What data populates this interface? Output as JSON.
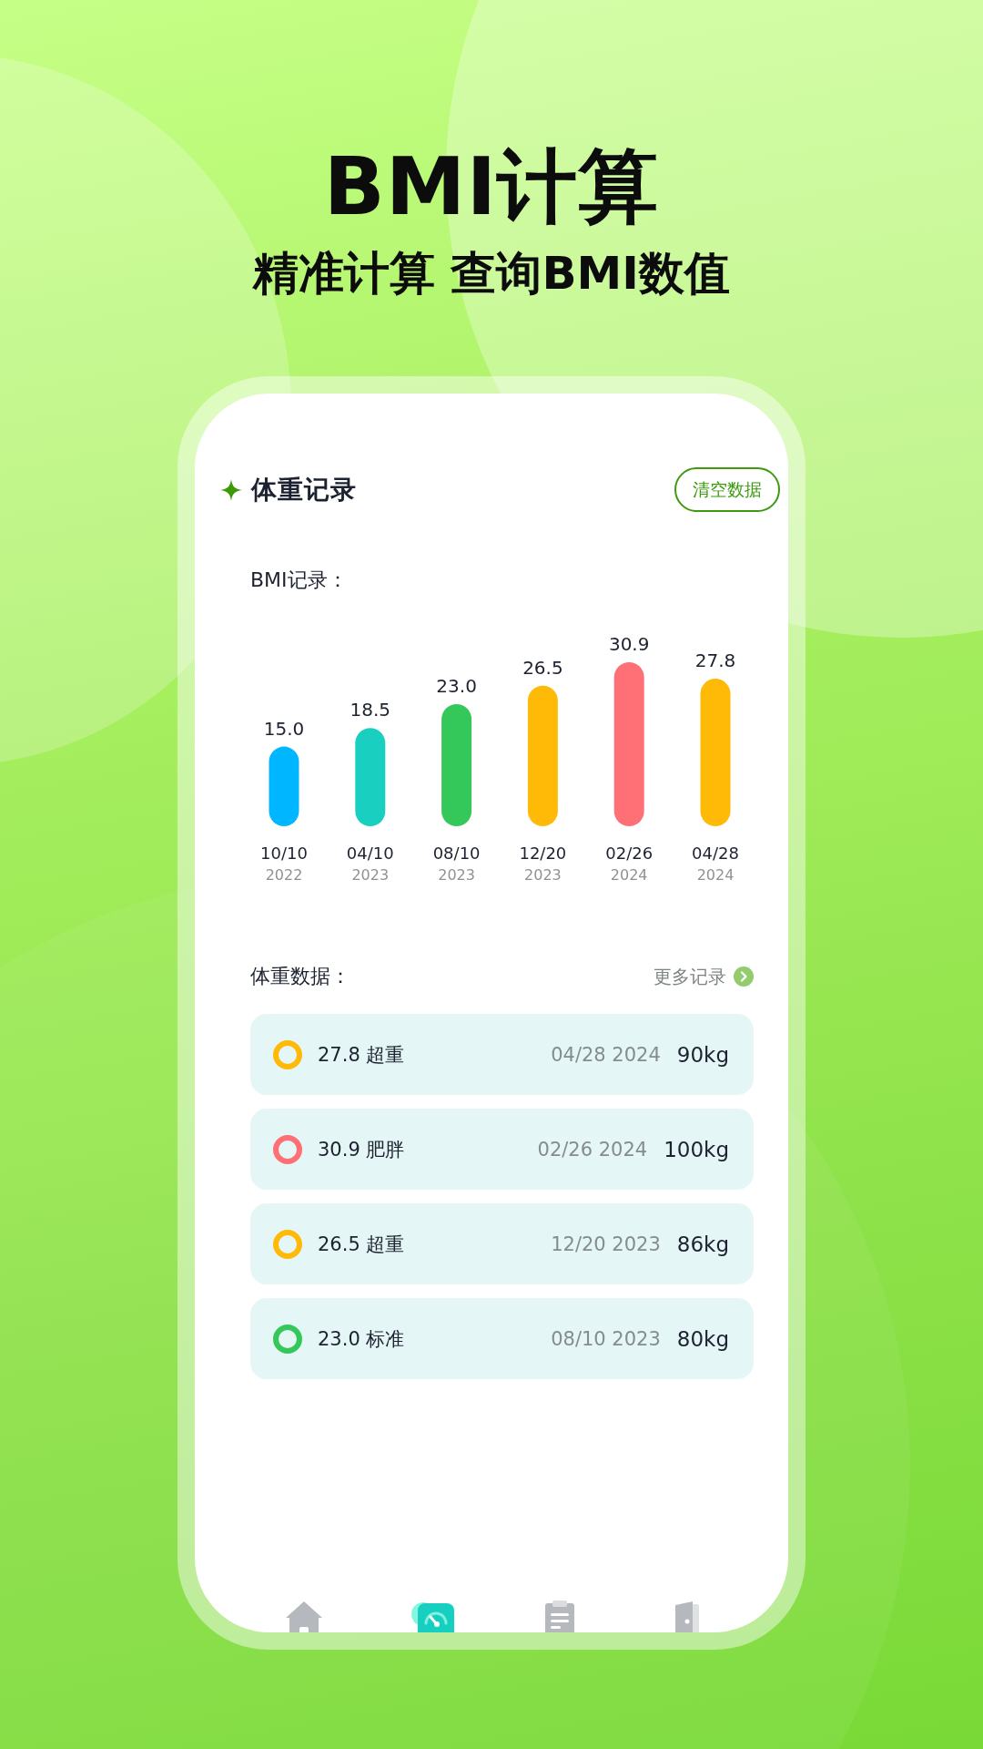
{
  "headline": {
    "title": "BMI计算",
    "subtitle": "精准计算 查询BMI数值"
  },
  "screen": {
    "header": {
      "title": "体重记录",
      "action": "清空数据"
    },
    "bmi_chart": {
      "title": "BMI记录：",
      "chart_data": {
        "type": "bar",
        "categories": [
          "10/10",
          "04/10",
          "08/10",
          "12/20",
          "02/26",
          "04/28"
        ],
        "values": [
          15.0,
          18.5,
          23.0,
          26.5,
          30.9,
          27.8
        ],
        "value_labels": [
          "15.0",
          "18.5",
          "23.0",
          "26.5",
          "30.9",
          "27.8"
        ]
      },
      "bars": [
        {
          "year": "2022",
          "color": "#00b7ff"
        },
        {
          "year": "2023",
          "color": "#18cfc0"
        },
        {
          "year": "2023",
          "color": "#34c759"
        },
        {
          "year": "2023",
          "color": "#ffba08"
        },
        {
          "year": "2024",
          "color": "#ff6f76"
        },
        {
          "year": "2024",
          "color": "#ffba08"
        }
      ]
    },
    "weight_data": {
      "title": "体重数据：",
      "more_link": "更多记录",
      "records": [
        {
          "bmi": "27.8",
          "status": "超重",
          "date": "04/28 2024",
          "weight": "90kg",
          "color": "#ffba08"
        },
        {
          "bmi": "30.9",
          "status": "肥胖",
          "date": "02/26 2024",
          "weight": "100kg",
          "color": "#ff6f76"
        },
        {
          "bmi": "26.5",
          "status": "超重",
          "date": "12/20 2023",
          "weight": "86kg",
          "color": "#ffba08"
        },
        {
          "bmi": "23.0",
          "status": "标准",
          "date": "08/10 2023",
          "weight": "80kg",
          "color": "#34c759"
        }
      ]
    },
    "tab_bar": [
      {
        "kind": "home",
        "selected": false
      },
      {
        "kind": "gauge",
        "selected": true
      },
      {
        "kind": "clipboard",
        "selected": false
      },
      {
        "kind": "door",
        "selected": false
      }
    ]
  }
}
